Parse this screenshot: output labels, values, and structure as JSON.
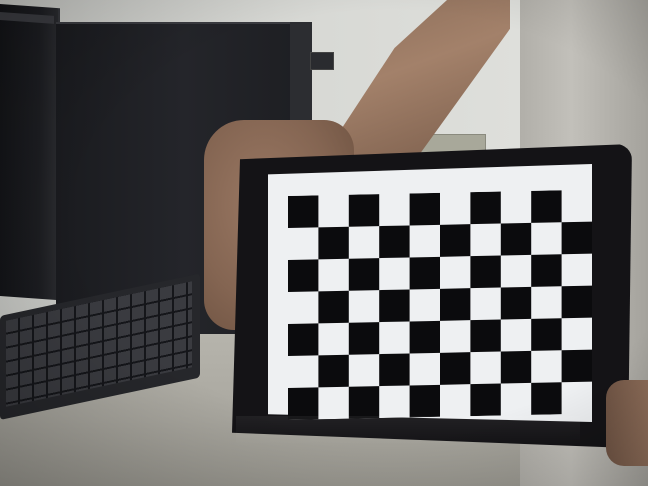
{
  "scene": {
    "subject": "calibration-checkerboard-on-tablet",
    "checkerboard": {
      "columns": 10,
      "rows": 7
    },
    "colors": {
      "dark_square": "#0b0b0d",
      "light_square": "#eef0f2"
    }
  }
}
